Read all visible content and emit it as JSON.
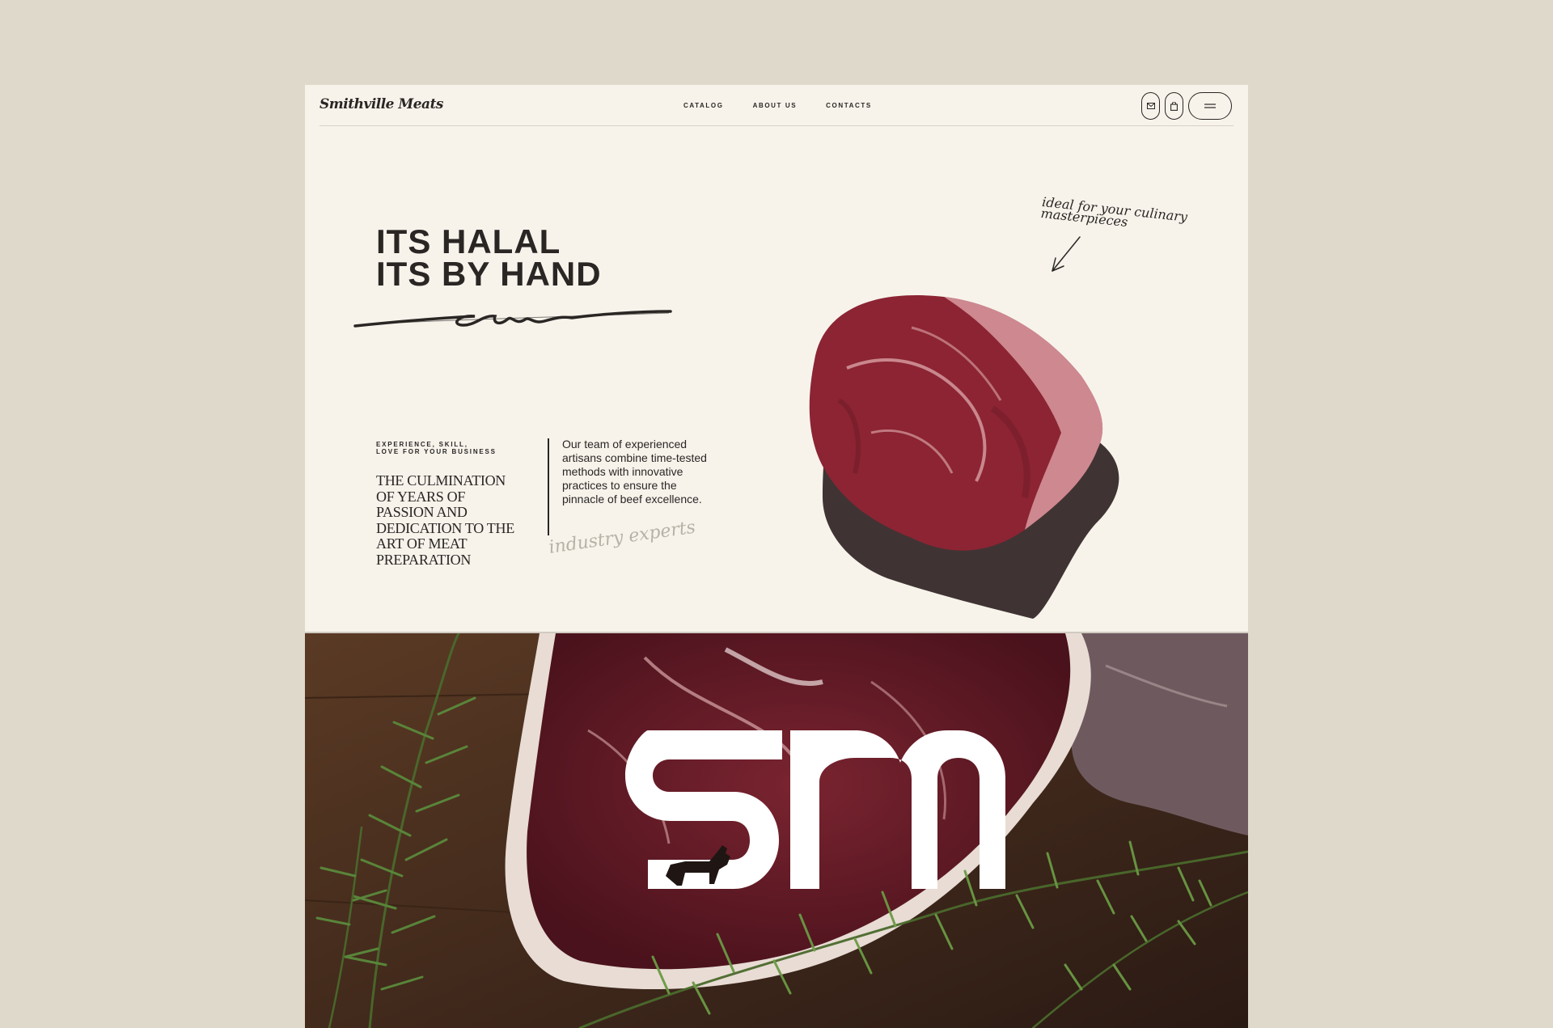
{
  "brand": {
    "name": "Smithville Meats"
  },
  "nav": {
    "items": [
      "CATALOG",
      "ABOUT US",
      "CONTACTS"
    ]
  },
  "header_icons": [
    "mail-icon",
    "bag-icon",
    "menu-icon"
  ],
  "hero": {
    "headline_line1": "ITS HALAL",
    "headline_line2": "ITS BY HAND",
    "eyebrow_line1": "EXPERIENCE, SKILL,",
    "eyebrow_line2": "LOVE FOR YOUR BUSINESS",
    "serif_statement": "THE CULMINATION OF YEARS OF PASSION AND DEDICATION TO THE ART OF MEAT PREPARATION",
    "body": "Our team of experienced artisans combine time-tested methods with innovative practices to ensure the pinnacle of beef excellence.",
    "script_caption": "industry experts",
    "script_note_line1": "ideal for your culinary",
    "script_note_line2": "masterpieces"
  },
  "lower_photo": {
    "monogram": "SM"
  },
  "colors": {
    "page_background": "#dfd9cb",
    "frame_background": "#f7f3eb",
    "ink": "#2a2624",
    "muted_script": "#b7b1a6",
    "meat_red": "#8c2433"
  }
}
